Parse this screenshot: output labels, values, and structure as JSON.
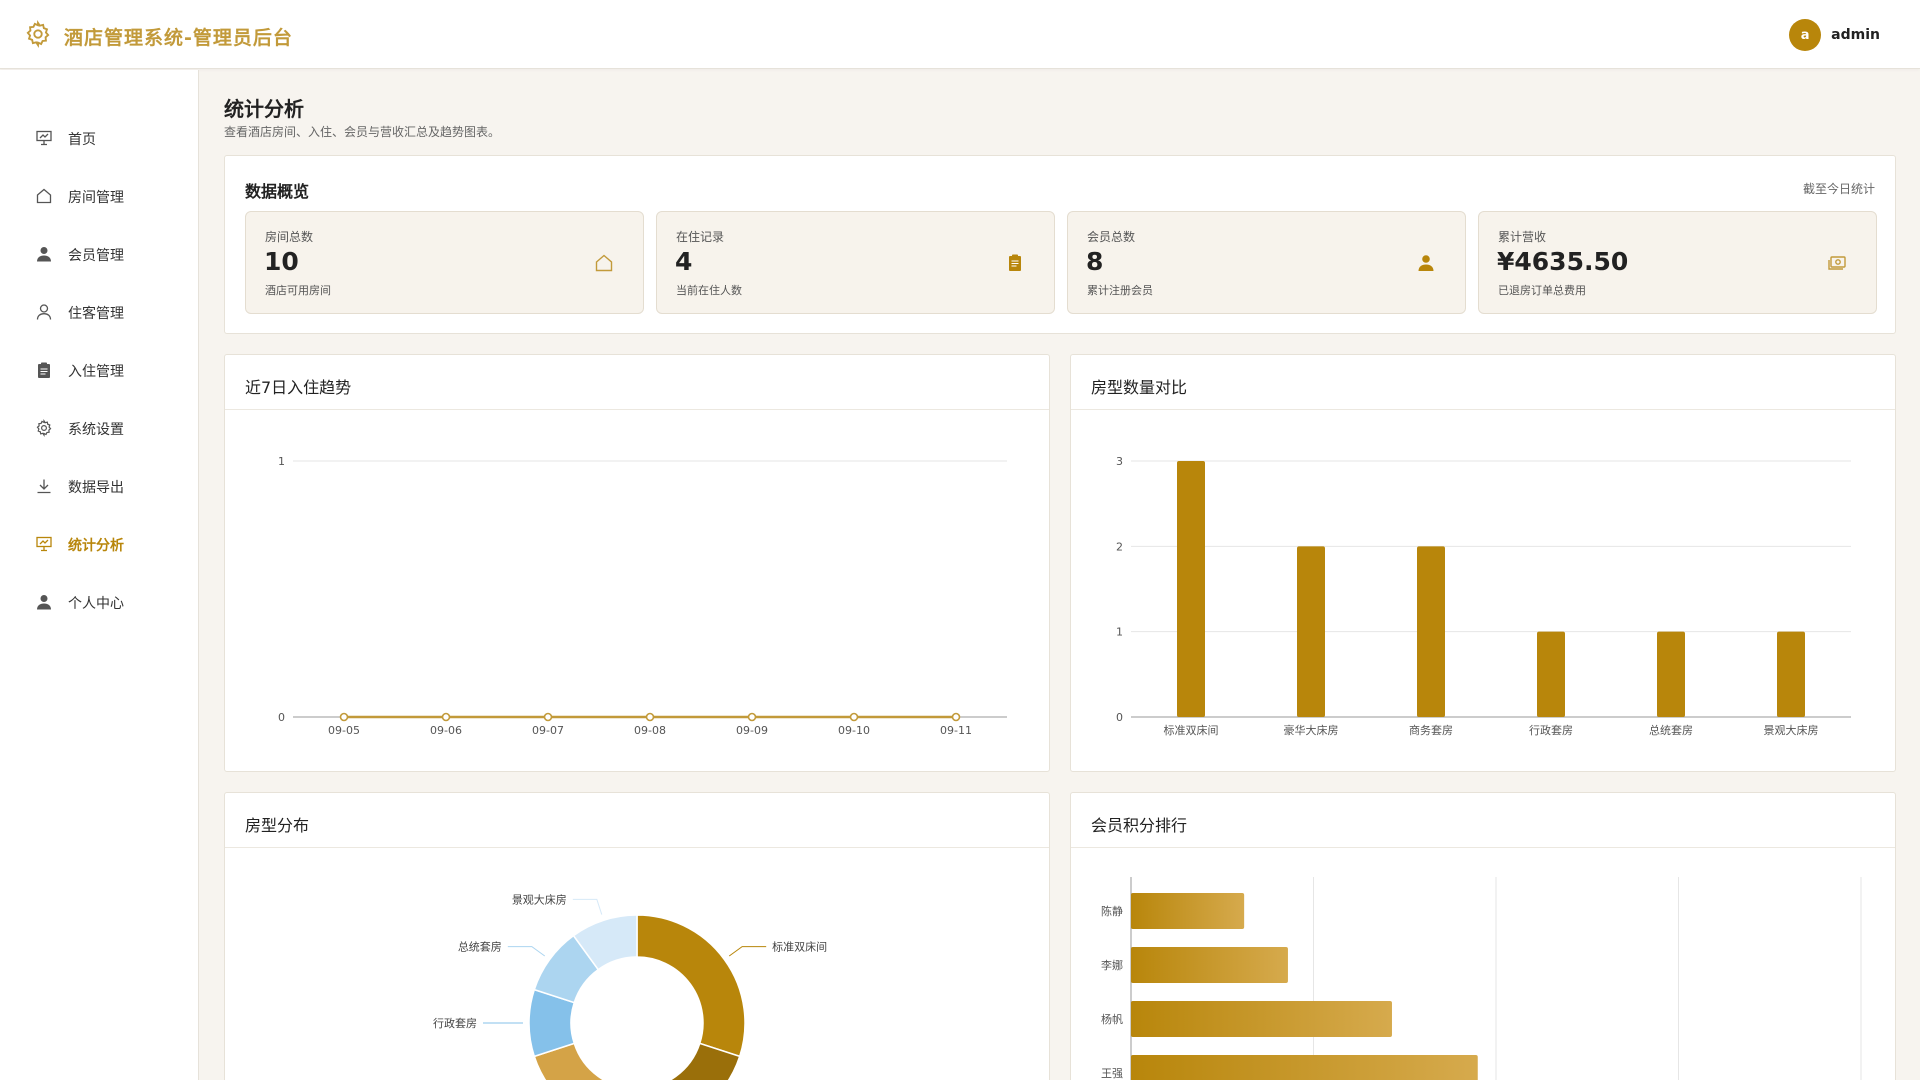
{
  "app": {
    "title": "酒店管理系统-管理员后台",
    "brand_color": "#c29a3a",
    "brand_icon": "gear-icon"
  },
  "user": {
    "avatar_letter": "a",
    "name": "admin"
  },
  "sidebar": {
    "items": [
      {
        "label": "首页",
        "icon": "presentation-icon"
      },
      {
        "label": "房间管理",
        "icon": "home-icon"
      },
      {
        "label": "会员管理",
        "icon": "user-filled-icon"
      },
      {
        "label": "住客管理",
        "icon": "user-outline-icon"
      },
      {
        "label": "入住管理",
        "icon": "clipboard-icon"
      },
      {
        "label": "系统设置",
        "icon": "gear-icon"
      },
      {
        "label": "数据导出",
        "icon": "download-icon"
      },
      {
        "label": "统计分析",
        "icon": "presentation-icon",
        "active": true
      },
      {
        "label": "个人中心",
        "icon": "user-filled-icon"
      }
    ]
  },
  "page": {
    "title": "统计分析",
    "subtitle": "查看酒店房间、入住、会员与营收汇总及趋势图表。"
  },
  "overview": {
    "title": "数据概览",
    "note": "截至今日统计",
    "stats": [
      {
        "label": "房间总数",
        "value": "10",
        "desc": "酒店可用房间",
        "icon": "home-icon"
      },
      {
        "label": "在住记录",
        "value": "4",
        "desc": "当前在住人数",
        "icon": "clipboard-icon"
      },
      {
        "label": "会员总数",
        "value": "8",
        "desc": "累计注册会员",
        "icon": "user-filled-icon"
      },
      {
        "label": "累计营收",
        "value": "¥4635.50",
        "desc": "已退房订单总费用",
        "icon": "money-icon"
      }
    ]
  },
  "panels": {
    "trend_title": "近7日入住趋势",
    "room_count_title": "房型数量对比",
    "distribution_title": "房型分布",
    "points_title": "会员积分排行"
  },
  "chart_data": [
    {
      "type": "line",
      "title": "近7日入住趋势",
      "x": [
        "09-05",
        "09-06",
        "09-07",
        "09-08",
        "09-09",
        "09-10",
        "09-11"
      ],
      "series": [
        {
          "values": [
            0,
            0,
            0,
            0,
            0,
            0,
            0
          ]
        }
      ],
      "ylim": [
        0,
        1
      ],
      "yticks": [
        0,
        1
      ],
      "color": "#c29a3a",
      "grid": true
    },
    {
      "type": "bar",
      "title": "房型数量对比",
      "categories": [
        "标准双床间",
        "豪华大床房",
        "商务套房",
        "行政套房",
        "总统套房",
        "景观大床房"
      ],
      "values": [
        3,
        2,
        2,
        1,
        1,
        1
      ],
      "ylim": [
        0,
        3
      ],
      "yticks": [
        0,
        1,
        2,
        3
      ],
      "color": "#b8860b",
      "grid": true
    },
    {
      "type": "pie",
      "title": "房型分布",
      "donut": true,
      "categories": [
        "标准双床间",
        "豪华大床房",
        "商务套房",
        "行政套房",
        "总统套房",
        "景观大床房"
      ],
      "values": [
        3,
        2,
        2,
        1,
        1,
        1
      ],
      "colors": [
        "#b8860b",
        "#9a6f0a",
        "#d4a347",
        "#85c1ea",
        "#acd5f0",
        "#d6e9f8"
      ],
      "visible_labels": [
        "景观大床房",
        "总统套房",
        "行政套房",
        "标准双床间"
      ]
    },
    {
      "type": "bar",
      "orientation": "horizontal",
      "title": "会员积分排行",
      "categories": [
        "陈静",
        "李娜",
        "杨帆",
        "王强"
      ],
      "values": [
        62,
        86,
        143,
        190
      ],
      "color": "#b8860b",
      "grid": true
    }
  ]
}
